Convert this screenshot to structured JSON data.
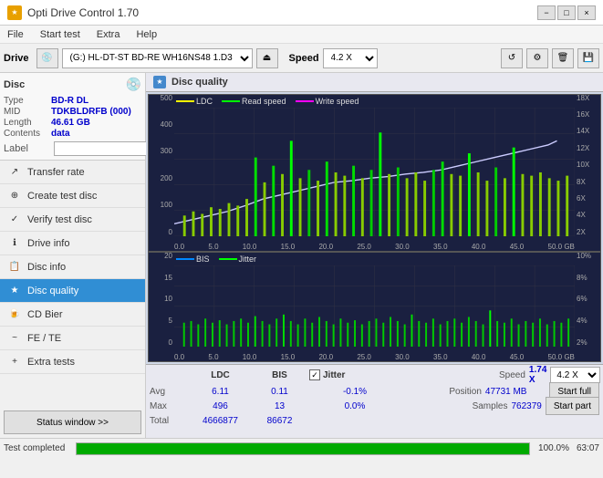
{
  "titlebar": {
    "title": "Opti Drive Control 1.70",
    "icon": "★",
    "controls": [
      "−",
      "□",
      "×"
    ]
  },
  "menubar": {
    "items": [
      "File",
      "Start test",
      "Extra",
      "Help"
    ]
  },
  "drive_toolbar": {
    "drive_label": "Drive",
    "drive_value": "(G:)  HL-DT-ST BD-RE  WH16NS48 1.D3",
    "speed_label": "Speed",
    "speed_value": "4.2 X"
  },
  "disc": {
    "title": "Disc",
    "type_label": "Type",
    "type_value": "BD-R DL",
    "mid_label": "MID",
    "mid_value": "TDKBLDRFB (000)",
    "length_label": "Length",
    "length_value": "46.61 GB",
    "contents_label": "Contents",
    "contents_value": "data",
    "label_label": "Label",
    "label_value": ""
  },
  "nav": {
    "items": [
      {
        "id": "transfer-rate",
        "label": "Transfer rate",
        "icon": "↗"
      },
      {
        "id": "create-test-disc",
        "label": "Create test disc",
        "icon": "⊕"
      },
      {
        "id": "verify-test-disc",
        "label": "Verify test disc",
        "icon": "✓"
      },
      {
        "id": "drive-info",
        "label": "Drive info",
        "icon": "ℹ"
      },
      {
        "id": "disc-info",
        "label": "Disc info",
        "icon": "💿"
      },
      {
        "id": "disc-quality",
        "label": "Disc quality",
        "icon": "★",
        "active": true
      },
      {
        "id": "cd-bier",
        "label": "CD Bier",
        "icon": "🍺"
      },
      {
        "id": "fe-te",
        "label": "FE / TE",
        "icon": "~"
      },
      {
        "id": "extra-tests",
        "label": "Extra tests",
        "icon": "+"
      }
    ],
    "status_button": "Status window >>"
  },
  "disc_quality": {
    "title": "Disc quality",
    "icon": "★",
    "top_chart": {
      "legend": [
        {
          "color": "#ffff00",
          "label": "LDC"
        },
        {
          "color": "#00ff00",
          "label": "Read speed"
        },
        {
          "color": "#ff00ff",
          "label": "Write speed"
        }
      ],
      "y_left": [
        "500",
        "400",
        "300",
        "200",
        "100",
        "0"
      ],
      "y_right": [
        "18X",
        "16X",
        "14X",
        "12X",
        "10X",
        "8X",
        "6X",
        "4X",
        "2X"
      ],
      "x_labels": [
        "0.0",
        "5.0",
        "10.0",
        "15.0",
        "20.0",
        "25.0",
        "30.0",
        "35.0",
        "40.0",
        "45.0",
        "50.0 GB"
      ]
    },
    "bottom_chart": {
      "legend": [
        {
          "color": "#0088ff",
          "label": "BIS"
        },
        {
          "color": "#00ff00",
          "label": "Jitter"
        }
      ],
      "y_left": [
        "20",
        "15",
        "10",
        "5",
        "0"
      ],
      "y_right": [
        "10%",
        "8%",
        "6%",
        "4%",
        "2%"
      ],
      "x_labels": [
        "0.0",
        "5.0",
        "10.0",
        "15.0",
        "20.0",
        "25.0",
        "30.0",
        "35.0",
        "40.0",
        "45.0",
        "50.0 GB"
      ]
    }
  },
  "stats": {
    "headers": [
      "",
      "LDC",
      "BIS",
      "",
      "Jitter",
      "",
      "Speed",
      ""
    ],
    "avg_label": "Avg",
    "avg_ldc": "6.11",
    "avg_bis": "0.11",
    "avg_jitter": "-0.1%",
    "max_label": "Max",
    "max_ldc": "496",
    "max_bis": "13",
    "max_jitter": "0.0%",
    "total_label": "Total",
    "total_ldc": "4666877",
    "total_bis": "86672",
    "speed_label": "Speed",
    "speed_value": "1.74 X",
    "speed_select": "4.2 X",
    "position_label": "Position",
    "position_value": "47731 MB",
    "samples_label": "Samples",
    "samples_value": "762379",
    "start_full": "Start full",
    "start_part": "Start part",
    "jitter_checked": true,
    "jitter_label": "Jitter"
  },
  "bottom": {
    "status": "Test completed",
    "progress": 100,
    "progress_text": "100.0%",
    "time": "63:07"
  }
}
